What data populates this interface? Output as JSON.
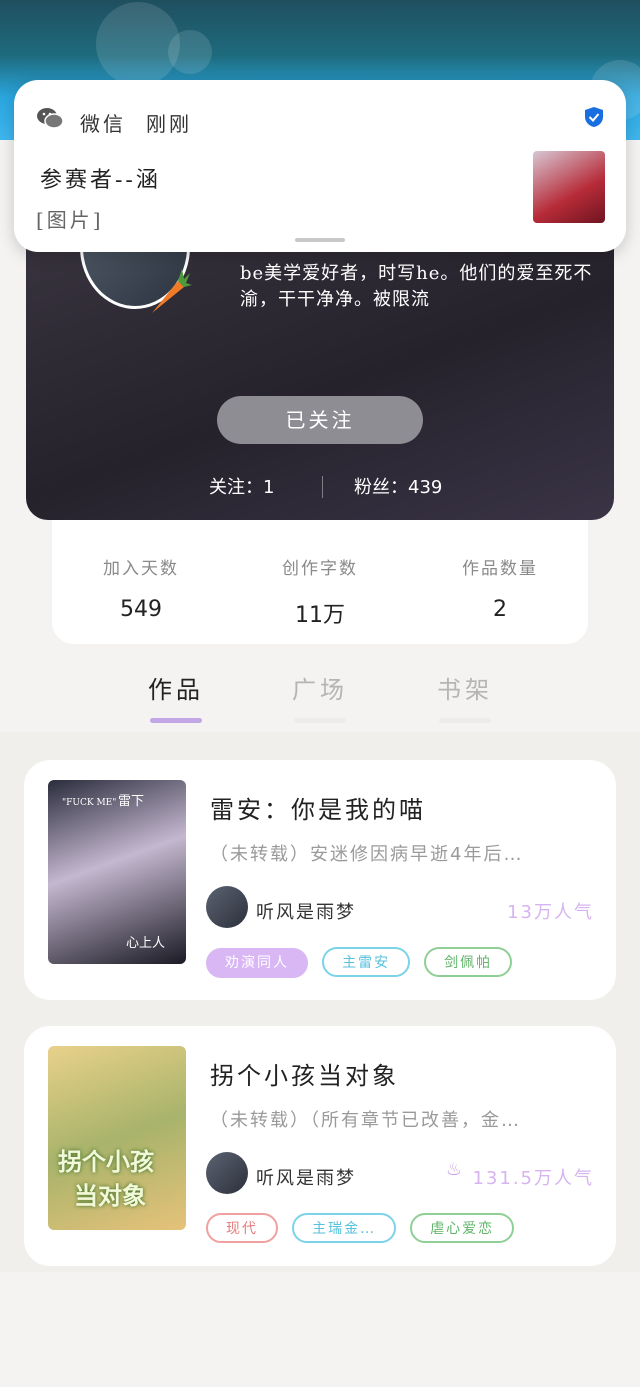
{
  "notification": {
    "app": "微信",
    "time": "刚刚",
    "sender": "参赛者--涵",
    "body": "[图片]"
  },
  "profile": {
    "bio": "be美学爱好者，时写he。他们的爱至死不渝，干干净净。被限流",
    "follow_button": "已关注",
    "following": "关注：1",
    "fans": "粉丝：439"
  },
  "stats": [
    {
      "label": "加入天数",
      "value": "549"
    },
    {
      "label": "创作字数",
      "value": "11万"
    },
    {
      "label": "作品数量",
      "value": "2"
    }
  ],
  "tabs": [
    {
      "label": "作品"
    },
    {
      "label": "广场"
    },
    {
      "label": "书架"
    }
  ],
  "works": [
    {
      "title": "雷安：你是我的喵",
      "desc": "（未转载）安迷修因病早逝4年后…",
      "author": "听风是雨梦",
      "popularity": "13万人气",
      "cover_text_a": "雷下",
      "cover_text_b": "\"FUCK ME\"",
      "cover_text_c": "心上人",
      "tags": [
        "劝演同人",
        "主雷安",
        "剑佩帕"
      ]
    },
    {
      "title": "拐个小孩当对象",
      "desc": "（未转载）（所有章节已改善，金…",
      "author": "听风是雨梦",
      "popularity": "131.5万人气",
      "cover_text_a": "拐个小孩",
      "cover_text_b": "当对象",
      "tags": [
        "现代",
        "主瑞金…",
        "虐心爱恋"
      ]
    }
  ]
}
